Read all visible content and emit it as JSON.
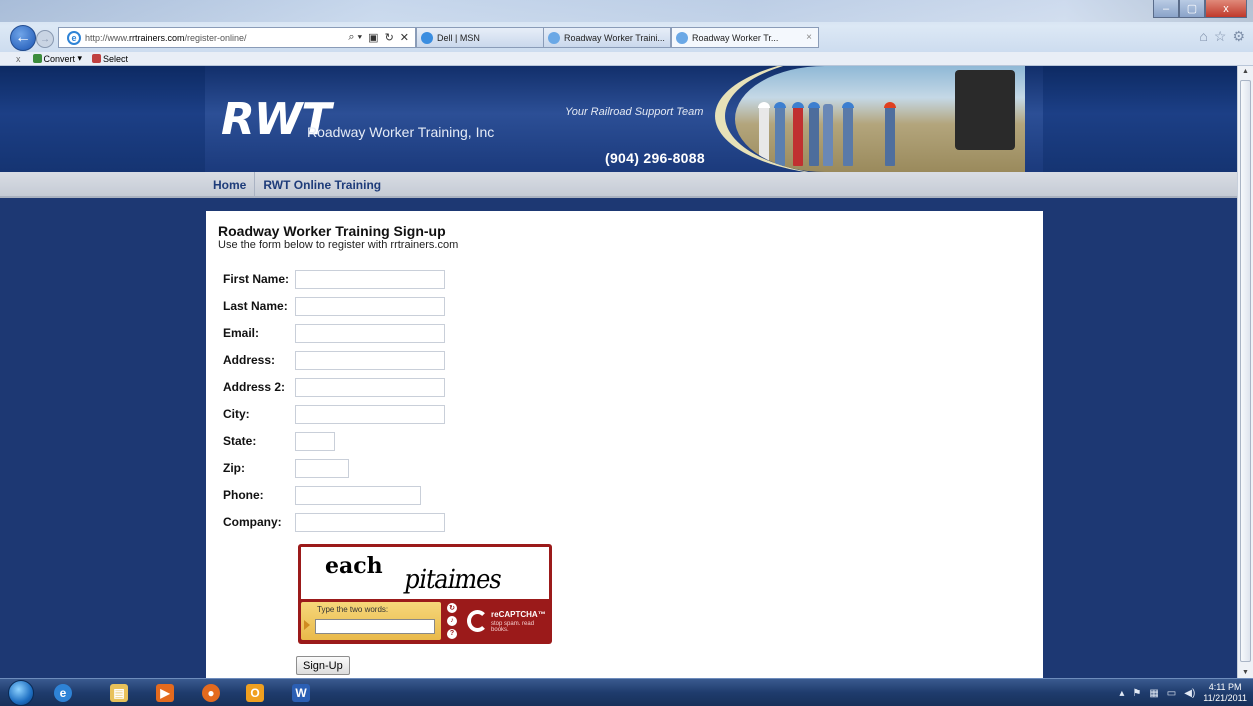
{
  "browser": {
    "url_prefix": "http://www.",
    "url_domain": "rrtrainers.com",
    "url_path": "/register-online/",
    "address_controls": [
      "⌕ ▾",
      "▣",
      "↻",
      "✕"
    ],
    "tabs": [
      {
        "label": "Dell | MSN",
        "active": false
      },
      {
        "label": "Roadway Worker Traini...",
        "active": false
      },
      {
        "label": "Roadway Worker Tr...",
        "active": true
      }
    ],
    "tab_close": "×",
    "command_bar": {
      "close": "x",
      "convert_label": "Convert",
      "select_label": "Select"
    },
    "window_buttons": {
      "minimize": "–",
      "maximize": "▢",
      "close": "x"
    }
  },
  "header": {
    "logo": "RWT",
    "company": "Roadway Worker Training, Inc",
    "slogan": "Your Railroad Support Team",
    "phone": "(904) 296-8088"
  },
  "nav": {
    "items": [
      {
        "label": "Home"
      },
      {
        "label": "RWT Online Training"
      }
    ]
  },
  "form": {
    "title": "Roadway Worker Training Sign-up",
    "subtitle": "Use the form below to register with rrtrainers.com",
    "fields": [
      {
        "label": "First Name:",
        "value": ""
      },
      {
        "label": "Last Name:",
        "value": ""
      },
      {
        "label": "Email:",
        "value": ""
      },
      {
        "label": "Address:",
        "value": ""
      },
      {
        "label": "Address 2:",
        "value": ""
      },
      {
        "label": "City:",
        "value": ""
      },
      {
        "label": "State:",
        "value": ""
      },
      {
        "label": "Zip:",
        "value": ""
      },
      {
        "label": "Phone:",
        "value": ""
      },
      {
        "label": "Company:",
        "value": ""
      }
    ],
    "captcha": {
      "word1": "each",
      "word2": "pitaimes",
      "prompt": "Type the two words:",
      "brand": "reCAPTCHA™",
      "motto": "stop spam. read books."
    },
    "submit_label": "Sign-Up"
  },
  "taskbar": {
    "apps": [
      {
        "name": "internet-explorer",
        "glyph": "e",
        "color": "#2e83d6"
      },
      {
        "name": "file-explorer",
        "glyph": "▤",
        "color": "#e8c15a"
      },
      {
        "name": "media-player",
        "glyph": "▶",
        "color": "#e46a1e"
      },
      {
        "name": "firefox",
        "glyph": "●",
        "color": "#e46a1e"
      },
      {
        "name": "outlook",
        "glyph": "O",
        "color": "#f0a020"
      },
      {
        "name": "word",
        "glyph": "W",
        "color": "#2b5fb4"
      }
    ],
    "tray_icons": [
      "▴",
      "⚑",
      "▦",
      "▭",
      "◀)"
    ],
    "time": "4:11 PM",
    "date": "11/21/2011"
  },
  "colors": {
    "page_bg": "#1d3873",
    "nav_link": "#1e3c7a",
    "captcha_red": "#9b1a1a"
  }
}
